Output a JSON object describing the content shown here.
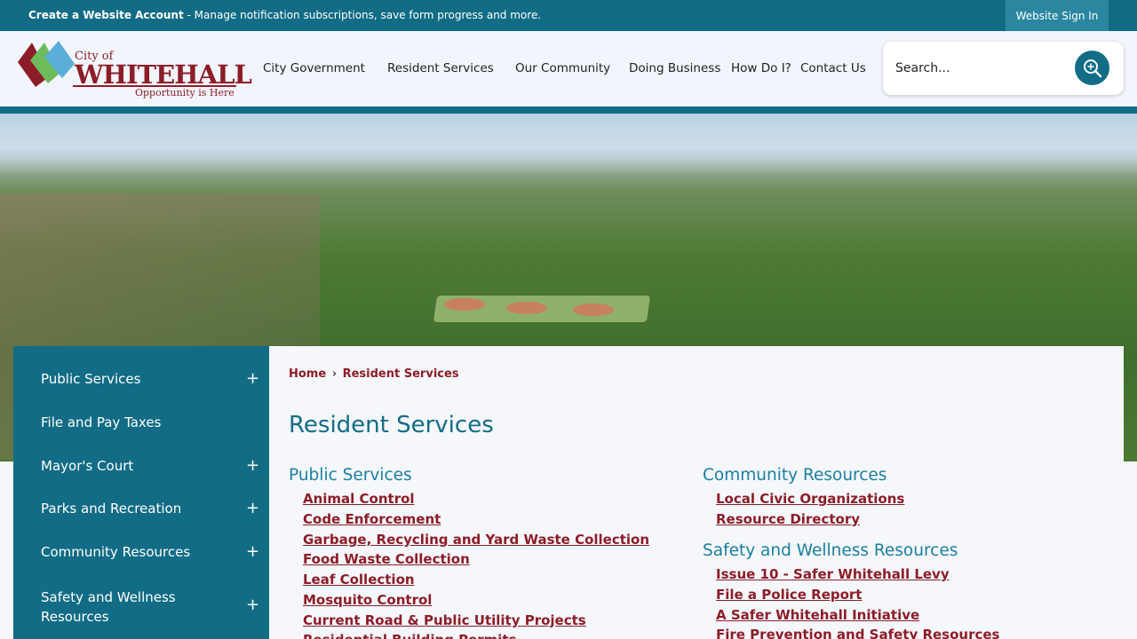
{
  "topbar": {
    "create_bold": "Create a Website Account",
    "create_rest": " - Manage notification subscriptions, save form progress and more.",
    "signin": "Website Sign In"
  },
  "logo": {
    "city_of": "City of",
    "name": "WHITEHALL",
    "tagline": "Opportunity is Here"
  },
  "nav": [
    "City Government",
    "Resident Services",
    "Our Community",
    "Doing Business",
    "How Do I?",
    "Contact Us"
  ],
  "search": {
    "placeholder": "Search..."
  },
  "sidebar": {
    "items": [
      {
        "label": "Public Services",
        "expand": "+"
      },
      {
        "label": "File and Pay Taxes",
        "expand": ""
      },
      {
        "label": "Mayor's Court",
        "expand": "+"
      },
      {
        "label": "Parks and Recreation",
        "expand": "+"
      },
      {
        "label": "Community Resources",
        "expand": "+"
      },
      {
        "label": "Safety and Wellness Resources",
        "expand": "+"
      }
    ]
  },
  "breadcrumb": {
    "home": "Home",
    "sep": "›",
    "current": "Resident Services"
  },
  "page_title": "Resident Services",
  "sections": [
    {
      "title": "Public Services",
      "links": [
        "Animal Control",
        "Code Enforcement",
        "Garbage, Recycling and Yard Waste Collection",
        "Food Waste Collection",
        "Leaf Collection",
        "Mosquito Control",
        "Current Road & Public Utility Projects",
        "Residential Building Permits"
      ]
    },
    {
      "title": "Community Resources",
      "links": [
        "Local Civic Organizations",
        "Resource Directory"
      ]
    },
    {
      "title": "Safety and Wellness Resources",
      "links": [
        "Issue 10 - Safer Whitehall Levy",
        "File a Police Report",
        "A Safer Whitehall Initiative",
        "Fire Prevention and Safety Resources"
      ]
    }
  ],
  "colors": {
    "brand_teal": "#126c85",
    "brand_red": "#8c1d28",
    "section_blue": "#1b7fa0"
  },
  "icons": {
    "search": "search-icon",
    "expand": "plus-icon"
  }
}
